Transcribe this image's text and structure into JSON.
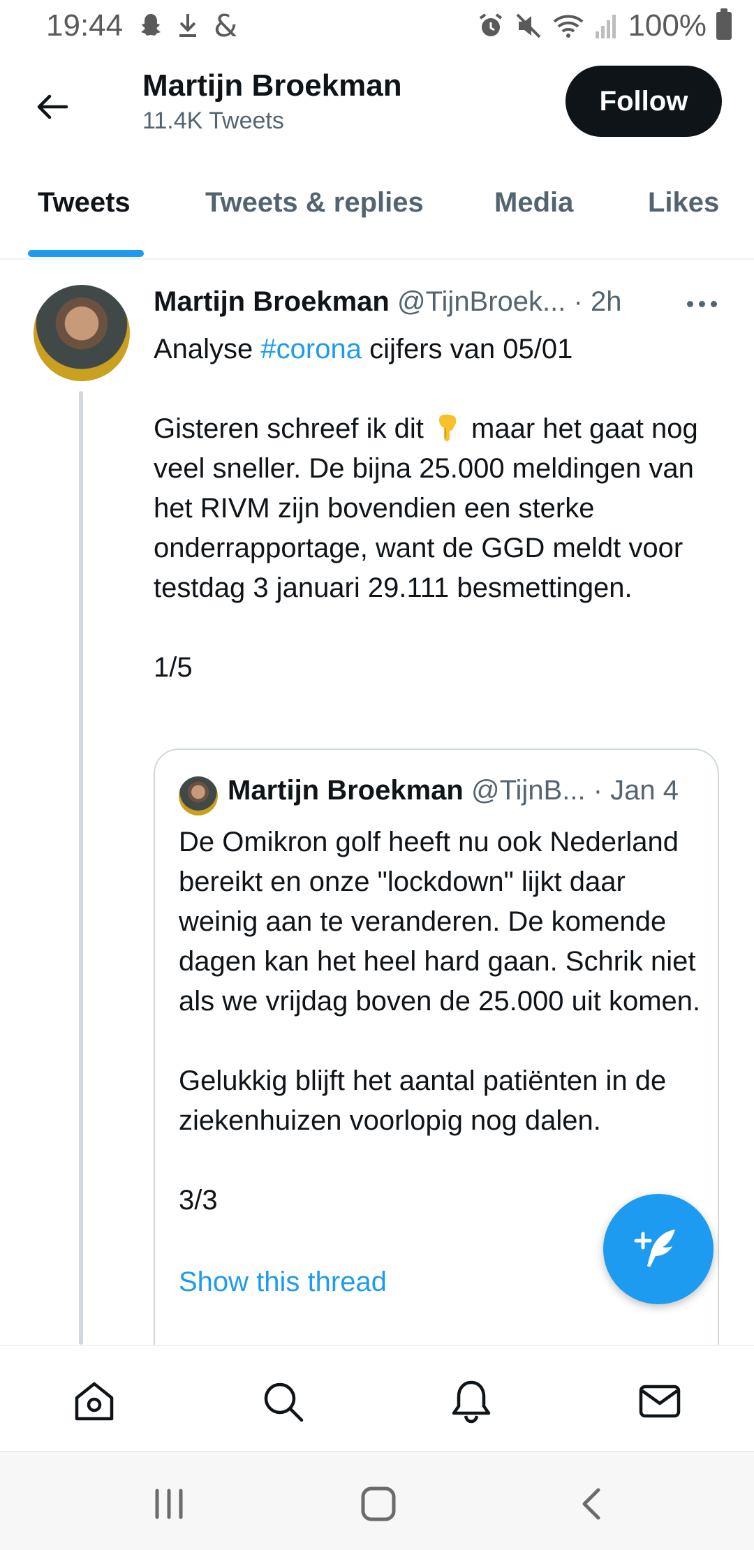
{
  "status_bar": {
    "time": "19:44",
    "battery": "100%",
    "left_icons": [
      "snapchat-icon",
      "download-icon",
      "threads-icon"
    ],
    "right_icons": [
      "alarm-icon",
      "mute-icon",
      "wifi-icon",
      "signal-icon",
      "battery-icon"
    ]
  },
  "header": {
    "name": "Martijn Broekman",
    "tweet_count": "11.4K Tweets",
    "follow_label": "Follow"
  },
  "tabs": [
    {
      "label": "Tweets",
      "active": true
    },
    {
      "label": "Tweets & replies",
      "active": false
    },
    {
      "label": "Media",
      "active": false
    },
    {
      "label": "Likes",
      "active": false
    }
  ],
  "tweet": {
    "name": "Martijn Broekman",
    "handle": "@TijnBroek...",
    "time": "· 2h",
    "line1_prefix": "Analyse ",
    "hashtag": "#corona",
    "line1_suffix": " cijfers van 05/01",
    "para2_before_emoji": "Gisteren schreef ik dit ",
    "para2_after_emoji": " maar het gaat nog veel sneller. De bijna 25.000 meldingen van het RIVM zijn bovendien een sterke onderrapportage, want de GGD meldt voor testdag 3 januari 29.111 besmettingen.",
    "counter": "1/5"
  },
  "quoted_tweet": {
    "name": "Martijn Broekman",
    "handle": "@TijnB...",
    "time": "· Jan 4",
    "para1": "De Omikron golf heeft nu ook Nederland bereikt en onze \"lockdown\" lijkt daar weinig aan te veranderen. De komende dagen kan het heel hard gaan. Schrik niet als we vrijdag boven de 25.000 uit komen.",
    "para2": "Gelukkig blijft het aantal patiënten in de ziekenhuizen voorlopig nog dalen.",
    "counter": "3/3",
    "show_thread": "Show this thread"
  },
  "colors": {
    "accent": "#1d9bf0",
    "text": "#0f1419",
    "secondary": "#536471",
    "border": "#cfd9de"
  },
  "bottom_nav": [
    "home-icon",
    "search-icon",
    "notifications-icon",
    "messages-icon"
  ],
  "system_nav": [
    "recents-icon",
    "home-button-icon",
    "back-icon"
  ]
}
